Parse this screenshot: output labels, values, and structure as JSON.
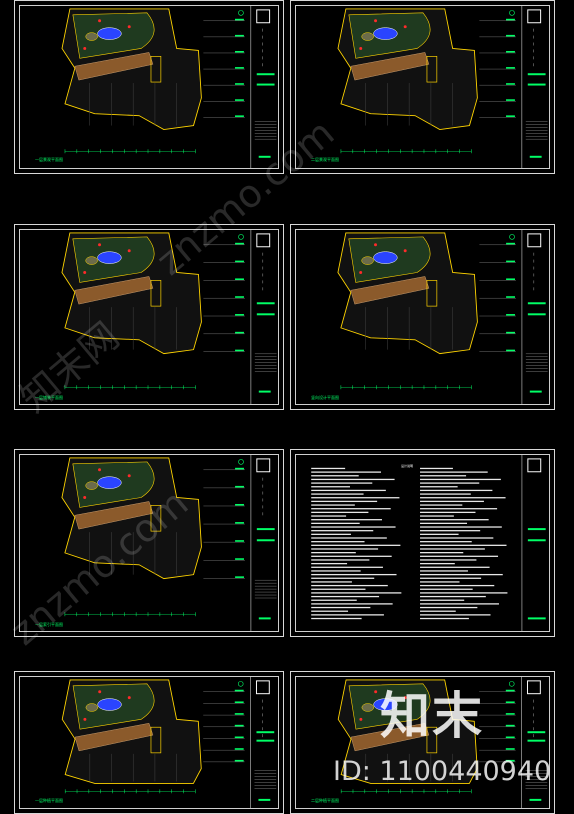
{
  "sheets": [
    {
      "caption": "一层景观平面图",
      "type": "plan"
    },
    {
      "caption": "二层景观平面图",
      "type": "plan"
    },
    {
      "caption": "一层铺装平面图",
      "type": "plan"
    },
    {
      "caption": "竖向设计平面图",
      "type": "plan"
    },
    {
      "caption": "一层索引平面图",
      "type": "plan"
    },
    {
      "caption": "设计说明",
      "type": "notes"
    },
    {
      "caption": "一层种植平面图",
      "type": "plan"
    },
    {
      "caption": "二层种植平面图",
      "type": "plan"
    }
  ],
  "watermark": {
    "brand": "知末",
    "id_text": "ID: 1100440940",
    "diag_text_1": "znzmo.com",
    "diag_text_2": "知末网",
    "diag_text_3": "znzmo.com"
  },
  "colors": {
    "background": "#000000",
    "frame": "#d8d8d8",
    "outline": "#ffd400",
    "annotation": "#00ff66",
    "path": "#8b5a2b",
    "accent_red": "#ff2a2a",
    "accent_blue": "#2a44ff"
  }
}
